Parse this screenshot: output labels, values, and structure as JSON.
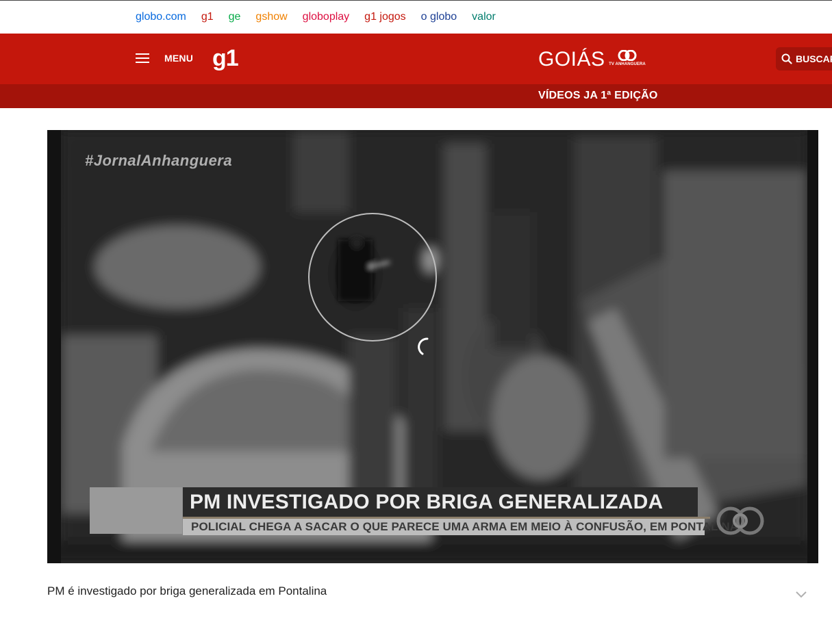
{
  "globo_links": [
    {
      "label": "globo.com",
      "color": "#0669de"
    },
    {
      "label": "g1",
      "color": "#c4170c"
    },
    {
      "label": "ge",
      "color": "#06aa48"
    },
    {
      "label": "gshow",
      "color": "#f08000"
    },
    {
      "label": "globoplay",
      "color": "#dd0e40"
    },
    {
      "label": "g1 jogos",
      "color": "#c4170c"
    },
    {
      "label": "o globo",
      "color": "#1c3f94"
    },
    {
      "label": "valor",
      "color": "#007c6c"
    }
  ],
  "header": {
    "menu_label": "MENU",
    "logo": "g1",
    "region": "GOIÁS",
    "affiliate": "TV ANHANGUERA",
    "search_label": "BUSCAR",
    "section_title": "VÍDEOS JA 1ª EDIÇÃO",
    "colors": {
      "primary": "#c4170c",
      "secondary": "#a3130a"
    }
  },
  "video": {
    "watermark": "#JornalAnhanguera",
    "headline": "PM INVESTIGADO POR BRIGA GENERALIZADA",
    "subheadline": "POLICIAL CHEGA A SACAR O QUE PARECE UMA ARMA EM MEIO À CONFUSÃO, EM PONTALINA",
    "state": "loading"
  },
  "caption": "PM é investigado por briga generalizada em Pontalina",
  "icons": {
    "menu": "hamburger-icon",
    "search": "search-icon",
    "expand": "chevron-down-icon",
    "loading": "spinner-icon"
  }
}
